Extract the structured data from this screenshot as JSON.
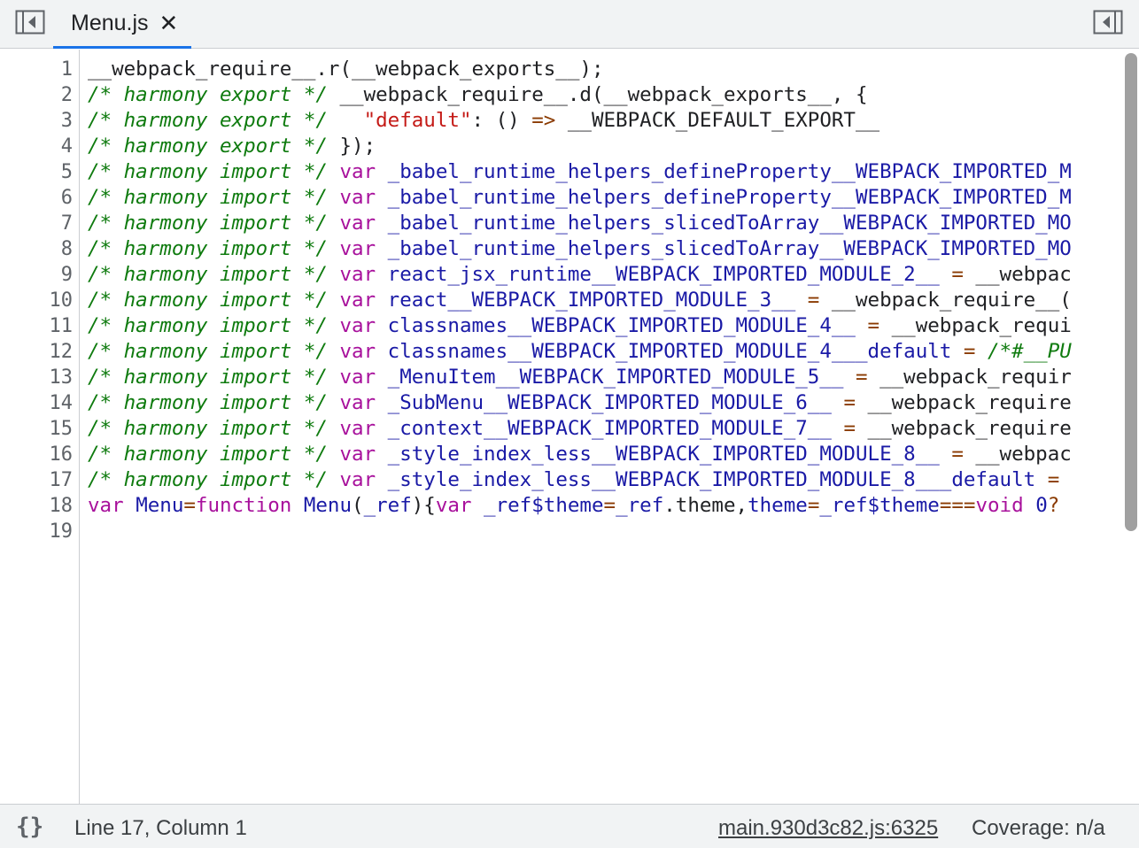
{
  "tab": {
    "label": "Menu.js",
    "close_glyph": "✕"
  },
  "icons": {
    "left_panel": "toggle-navigator-icon",
    "right_panel": "toggle-debugger-icon",
    "format": "pretty-print-icon"
  },
  "editor": {
    "lines": [
      {
        "no": "1",
        "tokens": [
          [
            "t",
            "__webpack_require__.r(__webpack_exports__);"
          ]
        ]
      },
      {
        "no": "2",
        "tokens": [
          [
            "cm",
            "/* harmony export */"
          ],
          [
            "t",
            " __webpack_require__.d(__webpack_exports__, {"
          ]
        ]
      },
      {
        "no": "3",
        "tokens": [
          [
            "cm",
            "/* harmony export */"
          ],
          [
            "t",
            "   "
          ],
          [
            "s",
            "\"default\""
          ],
          [
            "t",
            ": () "
          ],
          [
            "op",
            "=>"
          ],
          [
            "t",
            " __WEBPACK_DEFAULT_EXPORT__"
          ]
        ]
      },
      {
        "no": "4",
        "tokens": [
          [
            "cm",
            "/* harmony export */"
          ],
          [
            "t",
            " });"
          ]
        ]
      },
      {
        "no": "5",
        "tokens": [
          [
            "cm",
            "/* harmony import */"
          ],
          [
            "t",
            " "
          ],
          [
            "k",
            "var"
          ],
          [
            "t",
            " "
          ],
          [
            "v",
            "_babel_runtime_helpers_defineProperty__WEBPACK_IMPORTED_M"
          ]
        ]
      },
      {
        "no": "6",
        "tokens": [
          [
            "cm",
            "/* harmony import */"
          ],
          [
            "t",
            " "
          ],
          [
            "k",
            "var"
          ],
          [
            "t",
            " "
          ],
          [
            "v",
            "_babel_runtime_helpers_defineProperty__WEBPACK_IMPORTED_M"
          ]
        ]
      },
      {
        "no": "7",
        "tokens": [
          [
            "cm",
            "/* harmony import */"
          ],
          [
            "t",
            " "
          ],
          [
            "k",
            "var"
          ],
          [
            "t",
            " "
          ],
          [
            "v",
            "_babel_runtime_helpers_slicedToArray__WEBPACK_IMPORTED_MO"
          ]
        ]
      },
      {
        "no": "8",
        "tokens": [
          [
            "cm",
            "/* harmony import */"
          ],
          [
            "t",
            " "
          ],
          [
            "k",
            "var"
          ],
          [
            "t",
            " "
          ],
          [
            "v",
            "_babel_runtime_helpers_slicedToArray__WEBPACK_IMPORTED_MO"
          ]
        ]
      },
      {
        "no": "9",
        "tokens": [
          [
            "cm",
            "/* harmony import */"
          ],
          [
            "t",
            " "
          ],
          [
            "k",
            "var"
          ],
          [
            "t",
            " "
          ],
          [
            "v",
            "react_jsx_runtime__WEBPACK_IMPORTED_MODULE_2__"
          ],
          [
            "t",
            " "
          ],
          [
            "op",
            "="
          ],
          [
            "t",
            " __webpac"
          ]
        ]
      },
      {
        "no": "10",
        "tokens": [
          [
            "cm",
            "/* harmony import */"
          ],
          [
            "t",
            " "
          ],
          [
            "k",
            "var"
          ],
          [
            "t",
            " "
          ],
          [
            "v",
            "react__WEBPACK_IMPORTED_MODULE_3__"
          ],
          [
            "t",
            " "
          ],
          [
            "op",
            "="
          ],
          [
            "t",
            " __webpack_require__("
          ]
        ]
      },
      {
        "no": "11",
        "tokens": [
          [
            "cm",
            "/* harmony import */"
          ],
          [
            "t",
            " "
          ],
          [
            "k",
            "var"
          ],
          [
            "t",
            " "
          ],
          [
            "v",
            "classnames__WEBPACK_IMPORTED_MODULE_4__"
          ],
          [
            "t",
            " "
          ],
          [
            "op",
            "="
          ],
          [
            "t",
            " __webpack_requi"
          ]
        ]
      },
      {
        "no": "12",
        "tokens": [
          [
            "cm",
            "/* harmony import */"
          ],
          [
            "t",
            " "
          ],
          [
            "k",
            "var"
          ],
          [
            "t",
            " "
          ],
          [
            "v",
            "classnames__WEBPACK_IMPORTED_MODULE_4___default"
          ],
          [
            "t",
            " "
          ],
          [
            "op",
            "="
          ],
          [
            "t",
            " "
          ],
          [
            "cm",
            "/*#__PU"
          ]
        ]
      },
      {
        "no": "13",
        "tokens": [
          [
            "cm",
            "/* harmony import */"
          ],
          [
            "t",
            " "
          ],
          [
            "k",
            "var"
          ],
          [
            "t",
            " "
          ],
          [
            "v",
            "_MenuItem__WEBPACK_IMPORTED_MODULE_5__"
          ],
          [
            "t",
            " "
          ],
          [
            "op",
            "="
          ],
          [
            "t",
            " __webpack_requir"
          ]
        ]
      },
      {
        "no": "14",
        "tokens": [
          [
            "cm",
            "/* harmony import */"
          ],
          [
            "t",
            " "
          ],
          [
            "k",
            "var"
          ],
          [
            "t",
            " "
          ],
          [
            "v",
            "_SubMenu__WEBPACK_IMPORTED_MODULE_6__"
          ],
          [
            "t",
            " "
          ],
          [
            "op",
            "="
          ],
          [
            "t",
            " __webpack_require"
          ]
        ]
      },
      {
        "no": "15",
        "tokens": [
          [
            "cm",
            "/* harmony import */"
          ],
          [
            "t",
            " "
          ],
          [
            "k",
            "var"
          ],
          [
            "t",
            " "
          ],
          [
            "v",
            "_context__WEBPACK_IMPORTED_MODULE_7__"
          ],
          [
            "t",
            " "
          ],
          [
            "op",
            "="
          ],
          [
            "t",
            " __webpack_require"
          ]
        ]
      },
      {
        "no": "16",
        "tokens": [
          [
            "cm",
            "/* harmony import */"
          ],
          [
            "t",
            " "
          ],
          [
            "k",
            "var"
          ],
          [
            "t",
            " "
          ],
          [
            "v",
            "_style_index_less__WEBPACK_IMPORTED_MODULE_8__"
          ],
          [
            "t",
            " "
          ],
          [
            "op",
            "="
          ],
          [
            "t",
            " __webpac"
          ]
        ]
      },
      {
        "no": "17",
        "tokens": [
          [
            "cm",
            "/* harmony import */"
          ],
          [
            "t",
            " "
          ],
          [
            "k",
            "var"
          ],
          [
            "t",
            " "
          ],
          [
            "v",
            "_style_index_less__WEBPACK_IMPORTED_MODULE_8___default"
          ],
          [
            "t",
            " "
          ],
          [
            "op",
            "="
          ]
        ]
      },
      {
        "no": "18",
        "tokens": [
          [
            "k",
            "var"
          ],
          [
            "t",
            " "
          ],
          [
            "v",
            "Menu"
          ],
          [
            "op",
            "="
          ],
          [
            "k",
            "function"
          ],
          [
            "t",
            " "
          ],
          [
            "v",
            "Menu"
          ],
          [
            "t",
            "("
          ],
          [
            "v",
            "_ref"
          ],
          [
            "t",
            "){"
          ],
          [
            "k",
            "var"
          ],
          [
            "t",
            " "
          ],
          [
            "v",
            "_ref$theme"
          ],
          [
            "op",
            "="
          ],
          [
            "v",
            "_ref"
          ],
          [
            "t",
            ".theme,"
          ],
          [
            "v",
            "theme"
          ],
          [
            "op",
            "="
          ],
          [
            "v",
            "_ref$theme"
          ],
          [
            "op",
            "==="
          ],
          [
            "k",
            "void"
          ],
          [
            "t",
            " "
          ],
          [
            "n",
            "0"
          ],
          [
            "op",
            "?"
          ]
        ]
      },
      {
        "no": "19",
        "tokens": []
      }
    ]
  },
  "status": {
    "cursor": "Line 17, Column 1",
    "source_link": "main.930d3c82.js:6325",
    "coverage": "Coverage: n/a"
  }
}
